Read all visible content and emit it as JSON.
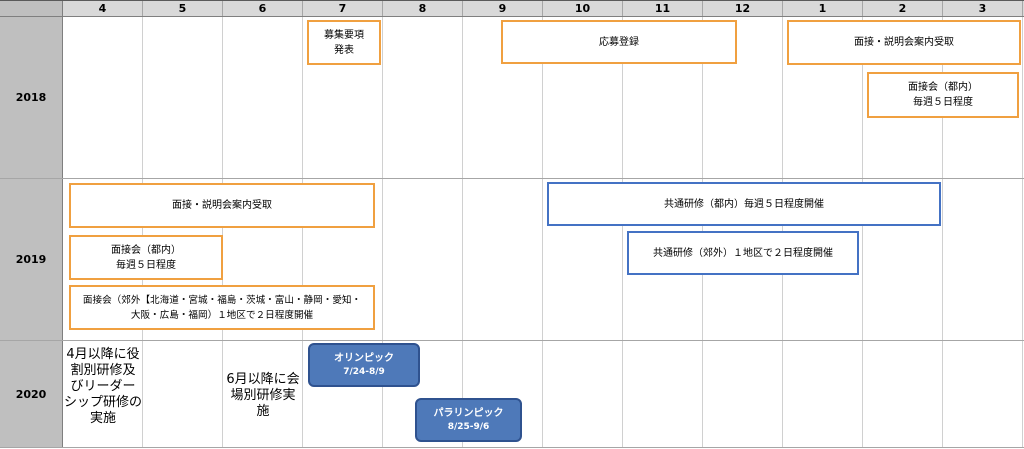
{
  "months": [
    "4",
    "5",
    "6",
    "7",
    "8",
    "9",
    "10",
    "11",
    "12",
    "1",
    "2",
    "3"
  ],
  "years": [
    "2018",
    "2019",
    "2020"
  ],
  "y2018": {
    "recruitment_announcement": [
      "募集要項",
      "発表"
    ],
    "application_registration": [
      "応募登録"
    ],
    "interview_notice": [
      "面接・説明会案内受取"
    ],
    "interview_tokyo": [
      "面接会（都内）",
      "毎週５日程度"
    ]
  },
  "y2019": {
    "interview_notice": [
      "面接・説明会案内受取"
    ],
    "interview_tokyo": [
      "面接会（都内）",
      "毎週５日程度"
    ],
    "interview_regional": [
      "面接会（郊外【北海道・宮城・福島・茨城・富山・静岡・愛知・",
      "大阪・広島・福岡）１地区で２日程度開催"
    ],
    "common_training_tokyo": [
      "共通研修（都内）毎週５日程度開催"
    ],
    "common_training_regional": [
      "共通研修（郊外）１地区で２日程度開催"
    ]
  },
  "y2020": {
    "role_training_note": [
      "4月以降に役",
      "割別研修及",
      "びリーダー",
      "シップ研修の",
      "実施"
    ],
    "venue_training_note": [
      "6月以降に会",
      "場別研修実",
      "施"
    ],
    "olympics": {
      "title": "オリンピック",
      "dates": "7/24-8/9"
    },
    "paralympics": {
      "title": "パラリンピック",
      "dates": "8/25-9/6"
    }
  },
  "colors": {
    "orange_border": "#f0a040",
    "blue_border": "#4472c4",
    "games_fill": "#4e79b9",
    "games_border": "#2f528f",
    "header_bg": "#d9d9d9",
    "year_column_bg": "#bfbfbf"
  }
}
